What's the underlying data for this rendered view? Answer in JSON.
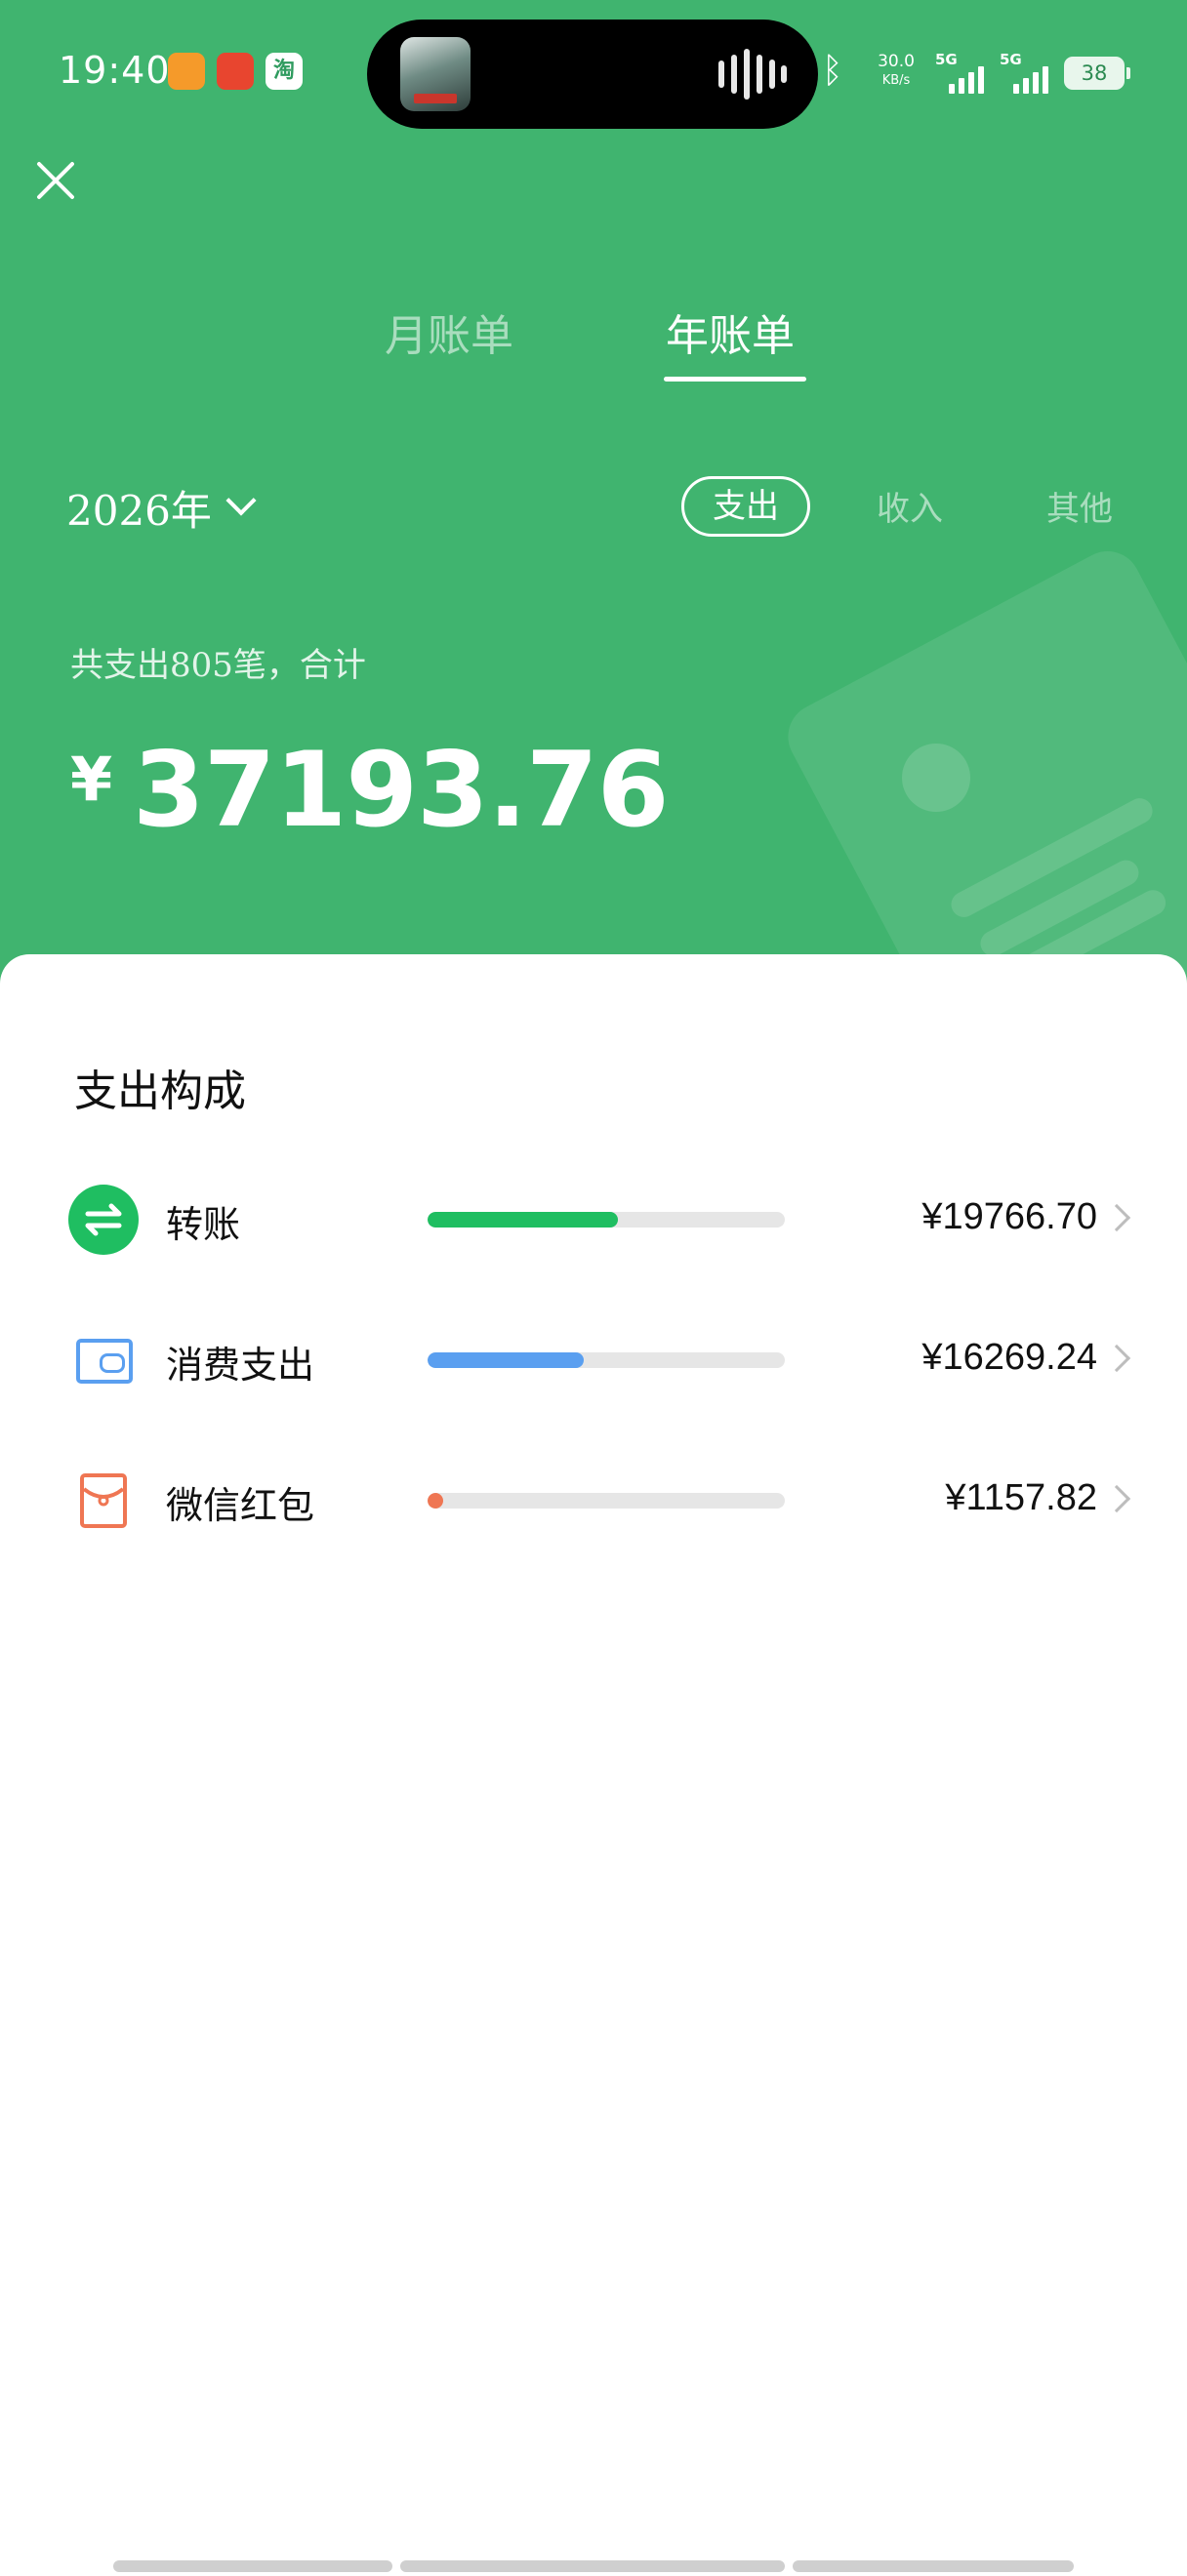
{
  "status_bar": {
    "time": "19:40",
    "net_speed_value": "30.0",
    "net_speed_unit": "KB/s",
    "network_1": "5G",
    "network_2": "5G",
    "battery": "38",
    "app_icon_taobao": "淘",
    "icons": [
      "orange-app-icon",
      "red-app-icon",
      "taobao-icon",
      "bluetooth-icon",
      "signal-icon",
      "battery-icon"
    ]
  },
  "header": {
    "close_icon": "close-icon",
    "tabs": [
      {
        "label": "月账单",
        "active": false
      },
      {
        "label": "年账单",
        "active": true
      }
    ],
    "year_label": "2026年",
    "filters": [
      {
        "label": "支出",
        "active": true
      },
      {
        "label": "收入",
        "active": false
      },
      {
        "label": "其他",
        "active": false
      }
    ],
    "summary_text": "共支出805笔，合计",
    "currency_symbol": "¥",
    "total_amount": "37193.76",
    "colors": {
      "background": "#40b46f"
    }
  },
  "breakdown": {
    "title": "支出构成",
    "items": [
      {
        "label": "转账",
        "amount": "¥19766.70",
        "share": 0.5315,
        "color": "#1fbe61",
        "icon": "transfer-icon"
      },
      {
        "label": "消费支出",
        "amount": "¥16269.24",
        "share": 0.4374,
        "color": "#5a9ff0",
        "icon": "wallet-icon"
      },
      {
        "label": "微信红包",
        "amount": "¥1157.82",
        "share": 0.0311,
        "color": "#ef7653",
        "icon": "red-packet-icon"
      }
    ]
  }
}
